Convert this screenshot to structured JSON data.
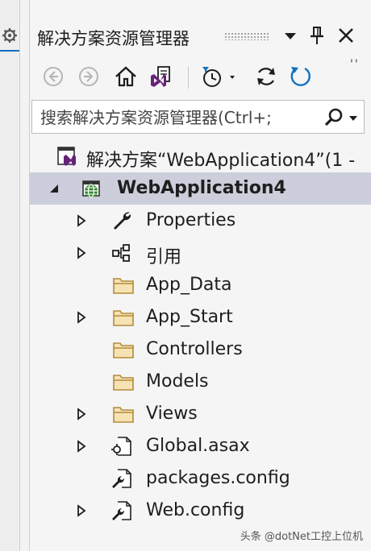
{
  "panel": {
    "title": "解决方案资源管理器"
  },
  "search": {
    "placeholder": "搜索解决方案资源管理器(Ctrl+;"
  },
  "tree": {
    "solution_label": "解决方案“WebApplication4”(1 -",
    "project_label": "WebApplication4",
    "items": [
      {
        "label": "Properties",
        "icon": "wrench-icon",
        "expandable": true
      },
      {
        "label": "引用",
        "icon": "references-icon",
        "expandable": true
      },
      {
        "label": "App_Data",
        "icon": "folder-icon",
        "expandable": false
      },
      {
        "label": "App_Start",
        "icon": "folder-icon",
        "expandable": true
      },
      {
        "label": "Controllers",
        "icon": "folder-icon",
        "expandable": false
      },
      {
        "label": "Models",
        "icon": "folder-icon",
        "expandable": false
      },
      {
        "label": "Views",
        "icon": "folder-icon",
        "expandable": true
      },
      {
        "label": "Global.asax",
        "icon": "asax-file-icon",
        "expandable": true
      },
      {
        "label": "packages.config",
        "icon": "config-file-icon",
        "expandable": false
      },
      {
        "label": "Web.config",
        "icon": "config-file-icon",
        "expandable": true
      }
    ]
  },
  "watermark": {
    "text": "头条 @dotNet工控上位机"
  },
  "colors": {
    "accent": "#0e70c0",
    "selection": "#cccedb",
    "folder": "#dcb67a",
    "visual_studio_purple": "#68217a",
    "globe_green": "#388a34"
  }
}
